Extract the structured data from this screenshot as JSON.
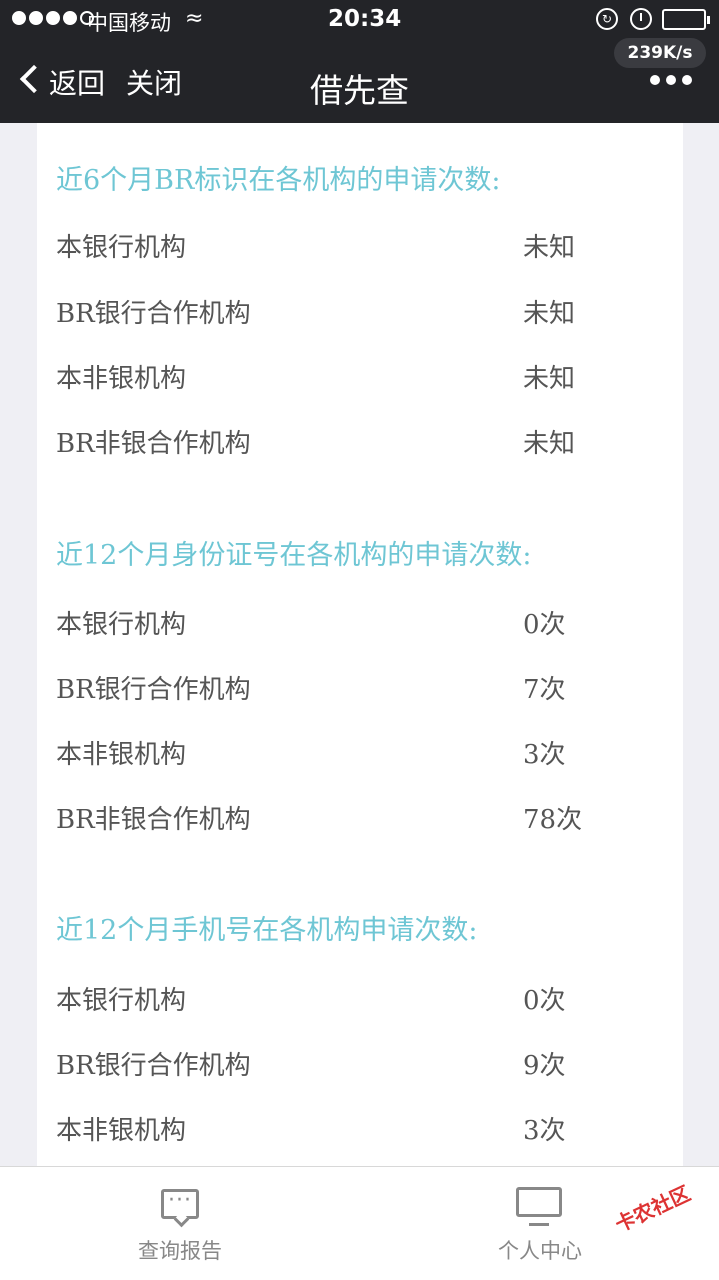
{
  "status_bar": {
    "carrier": "中国移动",
    "time": "20:34",
    "network_speed": "239K/s"
  },
  "nav": {
    "back_label": "返回",
    "close_label": "关闭",
    "title": "借先查"
  },
  "sections": [
    {
      "title": "近6个月BR标识在各机构的申请次数:",
      "rows": [
        {
          "label": "本银行机构",
          "value": "未知"
        },
        {
          "label": "BR银行合作机构",
          "value": "未知"
        },
        {
          "label": "本非银机构",
          "value": "未知"
        },
        {
          "label": "BR非银合作机构",
          "value": "未知"
        }
      ]
    },
    {
      "title": "近12个月身份证号在各机构的申请次数:",
      "rows": [
        {
          "label": "本银行机构",
          "value": "0次"
        },
        {
          "label": "BR银行合作机构",
          "value": "7次"
        },
        {
          "label": "本非银机构",
          "value": "3次"
        },
        {
          "label": "BR非银合作机构",
          "value": "78次"
        }
      ]
    },
    {
      "title": "近12个月手机号在各机构申请次数:",
      "rows": [
        {
          "label": "本银行机构",
          "value": "0次"
        },
        {
          "label": "BR银行合作机构",
          "value": "9次"
        },
        {
          "label": "本非银机构",
          "value": "3次"
        }
      ]
    }
  ],
  "tabbar": {
    "report_label": "查询报告",
    "user_label": "个人中心"
  },
  "watermark": "卡农社区",
  "colors": {
    "accent": "#6ec6d4",
    "nav_bg": "#232428"
  }
}
